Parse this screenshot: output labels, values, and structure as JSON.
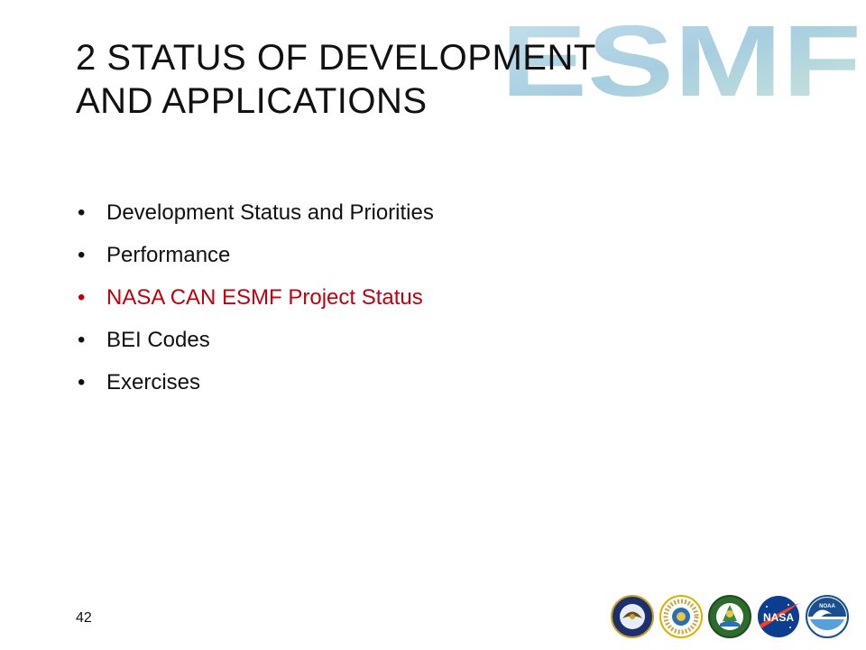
{
  "slide": {
    "title_line1": "2 STATUS OF DEVELOPMENT",
    "title_line2": "AND APPLICATIONS",
    "bullets": [
      {
        "text": "Development Status and Priorities"
      },
      {
        "text": "Performance"
      },
      {
        "text": "NASA CAN ESMF Project Status",
        "highlight": true
      },
      {
        "text": "BEI Codes"
      },
      {
        "text": "Exercises"
      }
    ],
    "bullet_glyph": "•",
    "page_number": "42"
  },
  "logo": {
    "text": "ESMF"
  },
  "colors": {
    "text": "#111111",
    "highlight": "#c0000e",
    "logo_fill": "#7fb7d6"
  },
  "seals": [
    {
      "icon": "dod-seal-icon"
    },
    {
      "icon": "nsf-seal-icon"
    },
    {
      "icon": "doe-seal-icon"
    },
    {
      "icon": "nasa-logo-icon",
      "text": "NASA"
    },
    {
      "icon": "noaa-logo-icon",
      "text": "NOAA"
    }
  ]
}
